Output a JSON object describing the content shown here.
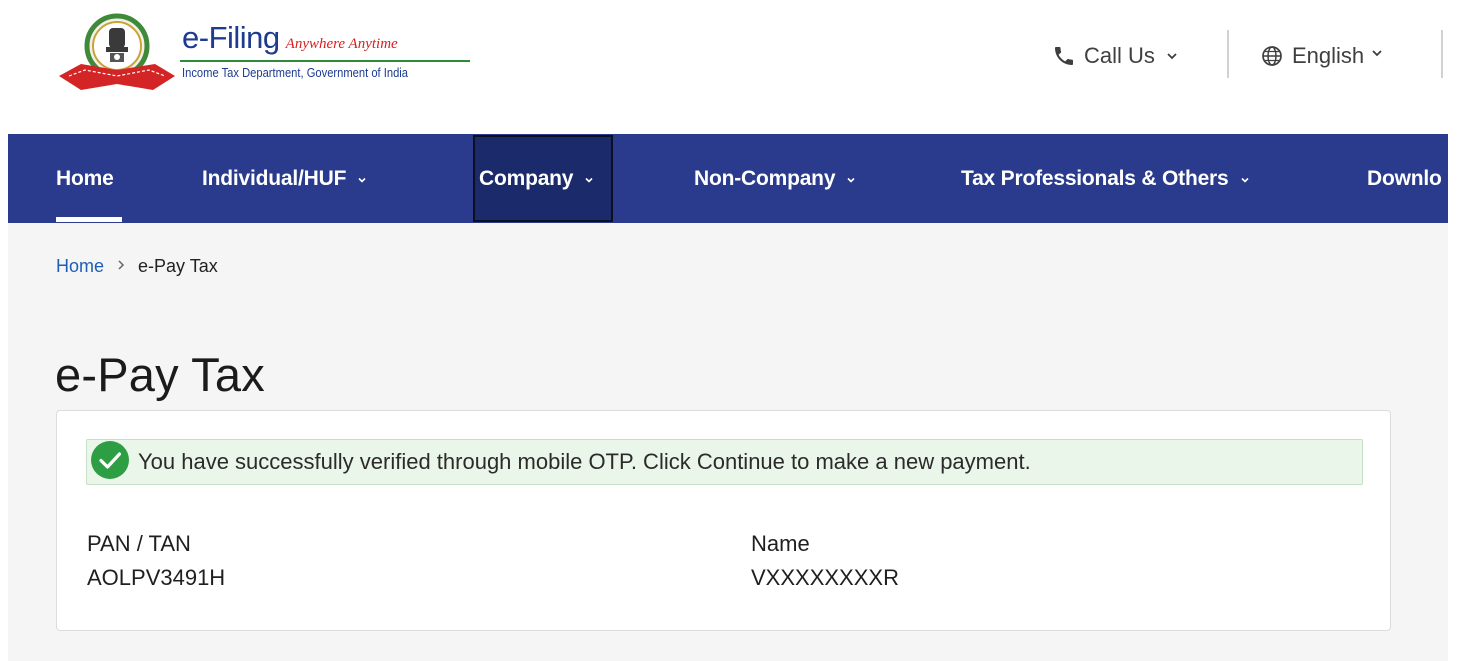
{
  "header": {
    "brand_main": "e-Filing",
    "brand_tagline": "Anywhere Anytime",
    "brand_sub": "Income Tax Department, Government of India",
    "emblem_icon": "emblem-logo-icon",
    "call_us_label": "Call Us",
    "language_label": "English"
  },
  "nav": {
    "items": [
      {
        "label": "Home",
        "active": true
      },
      {
        "label": "Individual/HUF"
      },
      {
        "label": "Company",
        "focused": true
      },
      {
        "label": "Non-Company"
      },
      {
        "label": "Tax Professionals & Others"
      },
      {
        "label": "Downlo"
      }
    ]
  },
  "breadcrumb": {
    "home": "Home",
    "current": "e-Pay Tax"
  },
  "page": {
    "title": "e-Pay Tax"
  },
  "alert": {
    "icon": "check-circle-icon",
    "message": "You have successfully verified through mobile OTP. Click Continue to make a new payment."
  },
  "details": {
    "pan_label": "PAN / TAN",
    "pan_value": "AOLPV3491H",
    "name_label": "Name",
    "name_value": "VXXXXXXXXR"
  },
  "colors": {
    "nav_bg": "#2a3a8c",
    "nav_focus_bg": "#1b2a6b",
    "link": "#1d5fb6",
    "success": "#2e9e44",
    "brand": "#1d3b8f",
    "tagline": "#d82020"
  }
}
